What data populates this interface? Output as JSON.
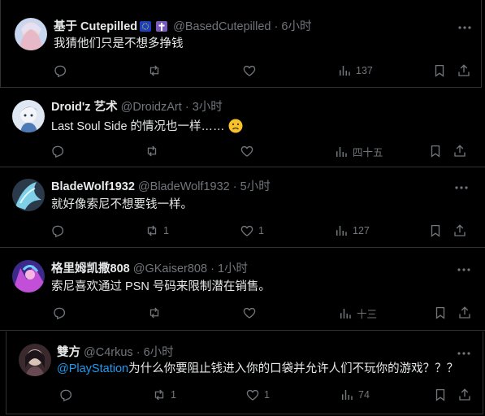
{
  "colors": {
    "background": "#000000",
    "text": "#e7e9ea",
    "muted": "#71767b",
    "link": "#1d9bf0",
    "border": "#2f3336"
  },
  "posts": [
    {
      "name": "基于 Cutepilled",
      "badges": [
        "eu-flag-icon",
        "cross-icon"
      ],
      "handle": "@BasedCutepilled",
      "time": "6小时",
      "text": "我猜他们只是不想多挣钱",
      "reply_count": "",
      "repost_count": "",
      "like_count": "",
      "view_count": "137"
    },
    {
      "name": "Droid'z 艺术",
      "handle": "@DroidzArt",
      "time": "3小时",
      "text": "Last Soul Side 的情况也一样……",
      "emoji": "frowning-face-icon",
      "reply_count": "",
      "repost_count": "",
      "like_count": "",
      "view_count": "四十五"
    },
    {
      "name": "BladeWolf1932",
      "handle": "@BladeWolf1932",
      "time": "5小时",
      "text": "就好像索尼不想要钱一样。",
      "reply_count": "",
      "repost_count": "1",
      "like_count": "1",
      "view_count": "127"
    },
    {
      "name": "格里姆凯撒808",
      "handle": "@GKaiser808",
      "time": "1小时",
      "text": "索尼喜欢通过 PSN 号码来限制潜在销售。",
      "reply_count": "",
      "repost_count": "",
      "like_count": "",
      "view_count": "十三"
    },
    {
      "name": "雙方",
      "handle": "@C4rkus",
      "time": "6小时",
      "mention": "@PlayStation",
      "text": "为什么你要阻止钱进入你的口袋并允许人们不玩你的游戏？？？",
      "reply_count": "",
      "repost_count": "1",
      "like_count": "1",
      "view_count": "74"
    }
  ],
  "separator": "·",
  "icons": {
    "more": "more-horizontal-icon",
    "reply": "reply-icon",
    "repost": "repost-icon",
    "like": "heart-icon",
    "views": "views-chart-icon",
    "bookmark": "bookmark-icon",
    "share": "share-icon"
  }
}
